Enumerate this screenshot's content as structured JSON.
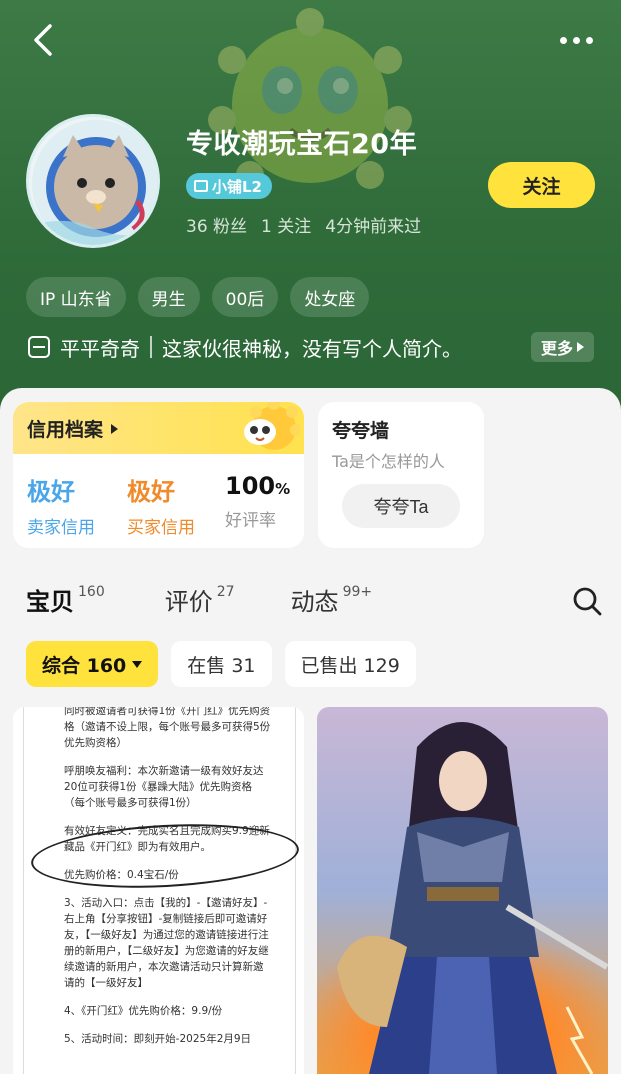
{
  "profile": {
    "shop_name": "专收潮玩宝石20年",
    "level_badge": "小铺L2",
    "stats": [
      "36 粉丝",
      "1 关注",
      "4分钟前来过"
    ],
    "follow_label": "关注",
    "tags": [
      "IP 山东省",
      "男生",
      "00后",
      "处女座"
    ],
    "signature_name": "平平奇奇",
    "bio": "这家伙很神秘，没有写个人简介。",
    "bio_more": "更多"
  },
  "credit": {
    "title": "信用档案",
    "seller_rating": "极好",
    "seller_label": "卖家信用",
    "buyer_rating": "极好",
    "buyer_label": "买家信用",
    "positive_rate": "100",
    "positive_unit": "%",
    "positive_label": "好评率",
    "colors": {
      "seller": "#4aa6e8",
      "buyer": "#f08a2b"
    }
  },
  "praise": {
    "title": "夸夸墙",
    "subtitle": "Ta是个怎样的人",
    "button": "夸夸Ta"
  },
  "tabs": [
    {
      "label": "宝贝",
      "count": "160"
    },
    {
      "label": "评价",
      "count": "27"
    },
    {
      "label": "动态",
      "count": "99+"
    }
  ],
  "filters": [
    {
      "label": "综合 160"
    },
    {
      "label": "在售 31"
    },
    {
      "label": "已售出 129"
    }
  ],
  "listing_doc": {
    "lines": [
      "同时被邀请者可获得1份《开门红》优先购资格（邀请不设上限，每个账号最多可获得5份优先购资格）",
      "呼朋唤友福利：本次新邀请一级有效好友达20位可获得1份《暴躁大陆》优先购资格（每个账号最多可获得1份）",
      "有效好友定义：完成实名且完成购买9.9迎新藏品《开门红》即为有效用户。",
      "优先购价格：0.4宝石/份",
      "3、活动入口：点击【我的】-【邀请好友】-右上角【分享按钮】-复制链接后即可邀请好友，【一级好友】为通过您的邀请链接进行注册的新用户，【二级好友】为您邀请的好友继续邀请的新用户，本次邀请活动只计算新邀请的【一级好友】",
      "4、《开门红》优先购价格：9.9/份",
      "5、活动时间：即刻开始-2025年2月9日"
    ]
  },
  "icons": {
    "back": "back-arrow-icon",
    "more": "more-dots-icon",
    "search": "search-icon"
  },
  "theme": {
    "header_green": "#2f6c3a",
    "accent_yellow": "#ffe23c",
    "badge_cyan": "#55c8d9"
  }
}
